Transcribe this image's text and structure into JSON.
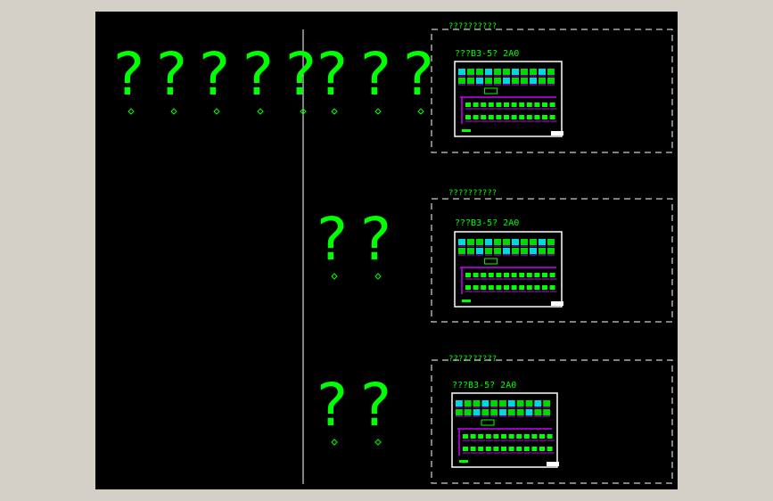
{
  "glyph": "?",
  "colors": {
    "viewport_bg": "#000000",
    "glyph": "#00ff00",
    "text": "#00ff00",
    "frame": "#ffffff",
    "divider": "#ffffff",
    "schematic_bus": "#cc00ff",
    "schematic_panel": "#00ff00",
    "schematic_accent": "#00ffff"
  },
  "question_rows": [
    {
      "glyph_count": 8
    },
    {
      "glyph_count": 2
    },
    {
      "glyph_count": 2
    }
  ],
  "sheets": [
    {
      "header": "??????????",
      "title": "???B3-5? 2A0"
    },
    {
      "header": "??????????",
      "title": "???B3-5? 2A0"
    },
    {
      "header": "??????????",
      "title": "???B3-5? 2A0"
    }
  ]
}
